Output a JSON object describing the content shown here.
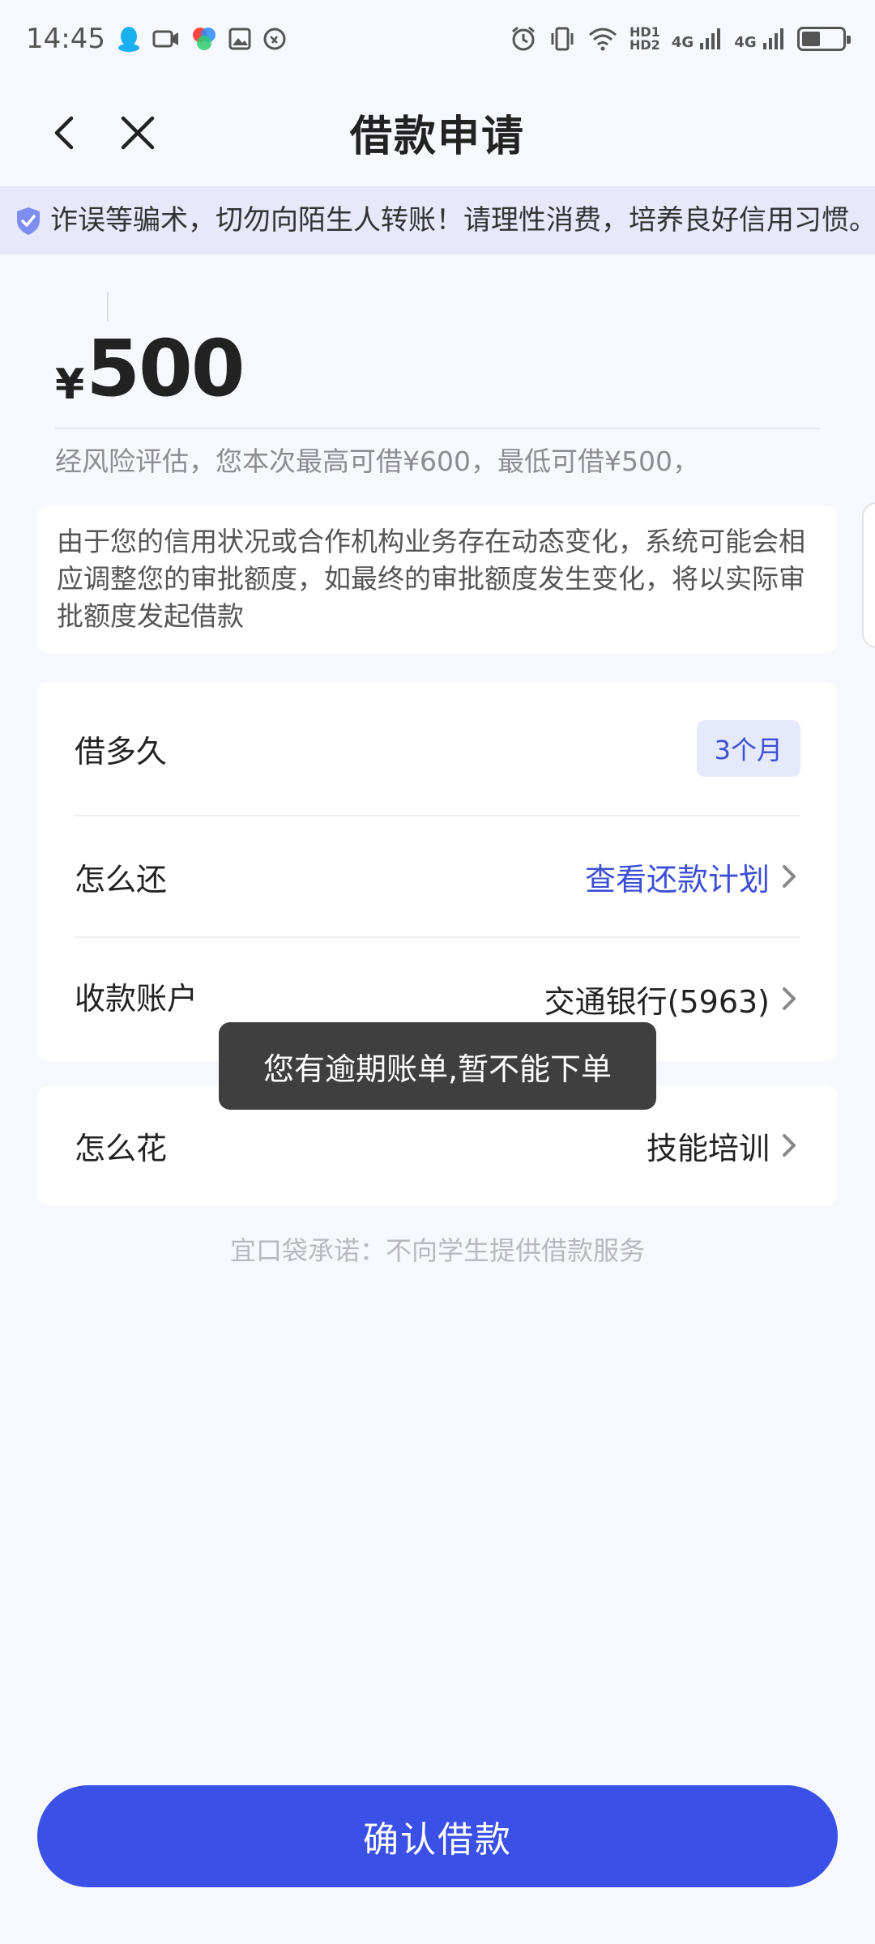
{
  "status_bar": {
    "time": "14:45",
    "hd_top": "HD1",
    "hd_bottom": "HD2",
    "network_1": "4G",
    "network_2": "4G",
    "battery_level": 0.45
  },
  "nav": {
    "title": "借款申请"
  },
  "notice": {
    "text": "诈误等骗术，切勿向陌生人转账！请理性消费，培养良好信用习惯。"
  },
  "amount": {
    "symbol": "¥",
    "value": "500",
    "hint": "经风险评估，您本次最高可借¥600，最低可借¥500，"
  },
  "info": {
    "text": "由于您的信用状况或合作机构业务存在动态变化，系统可能会相应调整您的审批额度，如最终的审批额度发生变化，将以实际审批额度发起借款"
  },
  "options": {
    "duration_label": "借多久",
    "duration_value": "3个月",
    "repay_label": "怎么还",
    "repay_value": "查看还款计划",
    "account_label": "收款账户",
    "account_value": "交通银行(5963)",
    "usage_label": "怎么花",
    "usage_value": "技能培训"
  },
  "toast": {
    "text": "您有逾期账单,暂不能下单"
  },
  "promise": {
    "text": "宜口袋承诺：不向学生提供借款服务"
  },
  "confirm": {
    "label": "确认借款"
  },
  "colors": {
    "accent": "#3a50e6",
    "link": "#3d4fd6",
    "notice_bg": "#e7e9fb",
    "page_bg": "#f7f8fd"
  }
}
